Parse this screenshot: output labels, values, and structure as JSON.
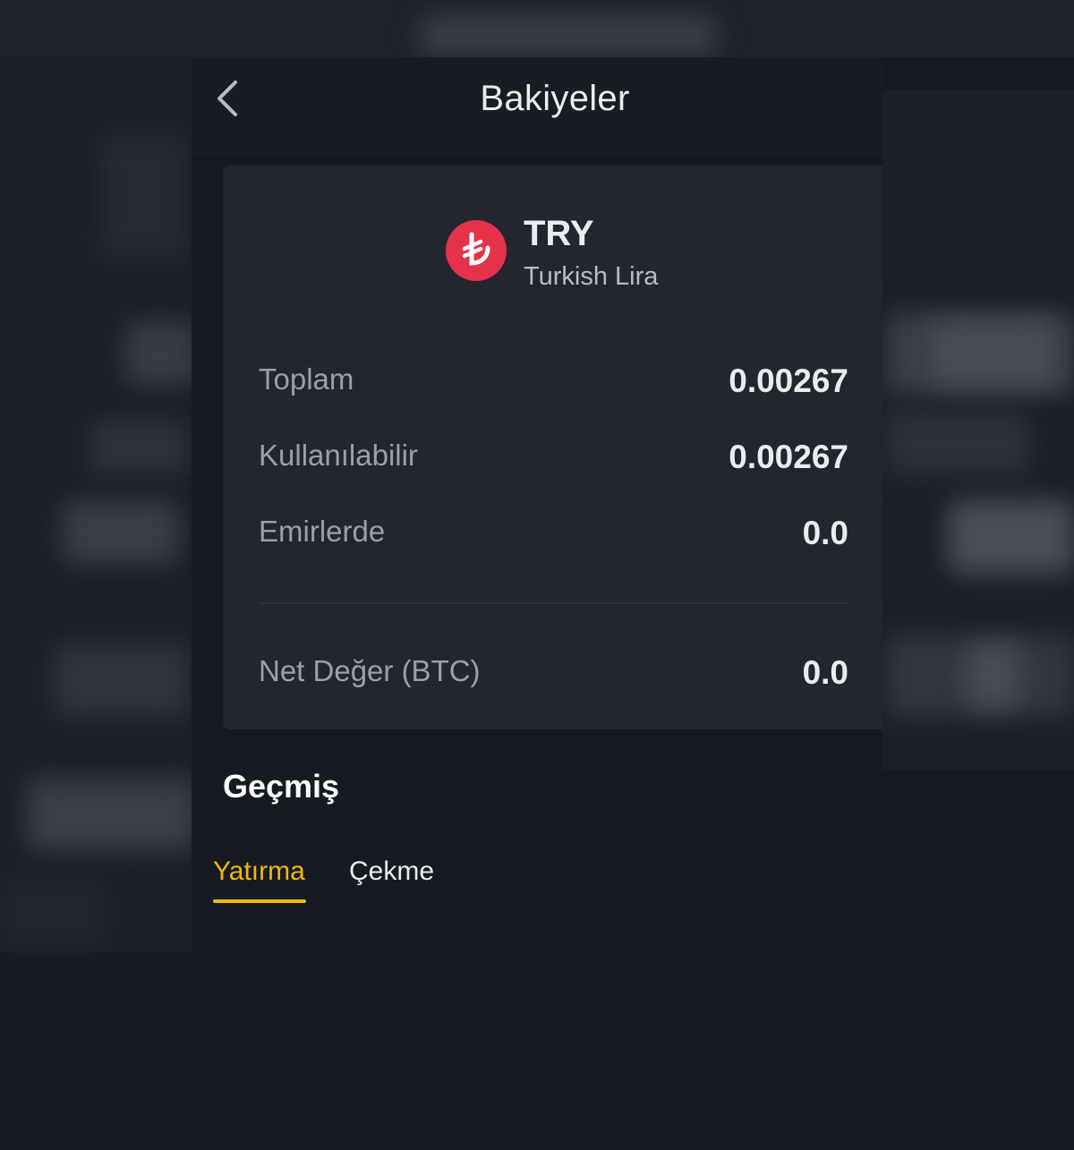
{
  "header": {
    "title": "Bakiyeler",
    "back_icon": "chevron-left-icon"
  },
  "asset": {
    "symbol": "TRY",
    "name": "Turkish Lira",
    "icon": "turkish-lira-icon",
    "icon_glyph": "₺",
    "icon_color": "#e4324a"
  },
  "balances": {
    "total_label": "Toplam",
    "total_value": "0.00267",
    "available_label": "Kullanılabilir",
    "available_value": "0.00267",
    "in_orders_label": "Emirlerde",
    "in_orders_value": "0.0",
    "net_value_label": "Net Değer (BTC)",
    "net_value_value": "0.0"
  },
  "history": {
    "title": "Geçmiş",
    "tabs": [
      {
        "label": "Yatırma",
        "active": true
      },
      {
        "label": "Çekme",
        "active": false
      }
    ]
  },
  "colors": {
    "accent": "#f0b90b",
    "background": "#161a21",
    "card": "#23262e"
  }
}
